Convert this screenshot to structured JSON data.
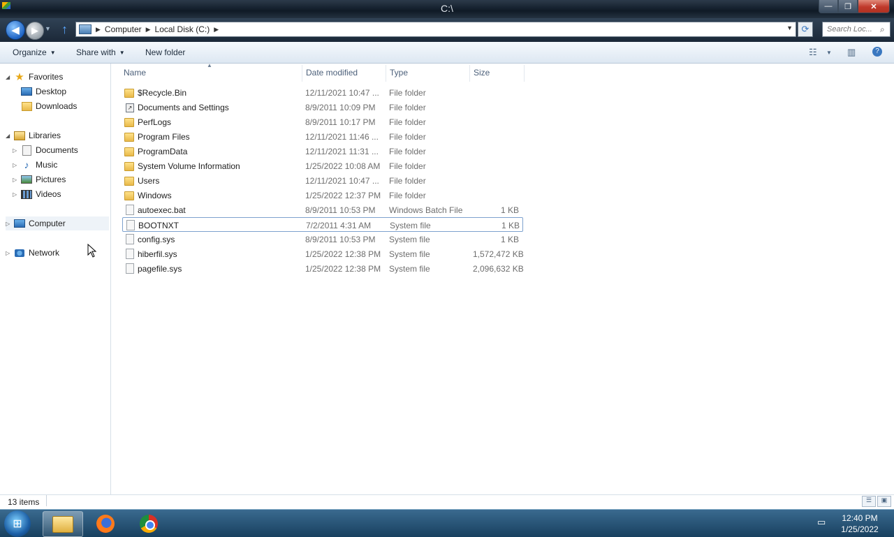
{
  "window": {
    "title": "C:\\",
    "minimize_label": "—",
    "maximize_label": "❐",
    "close_label": "✕"
  },
  "navigation": {
    "breadcrumbs": [
      "Computer",
      "Local Disk (C:)"
    ],
    "search_placeholder": "Search Loc..."
  },
  "toolbar": {
    "organize_label": "Organize",
    "share_label": "Share with",
    "new_folder_label": "New folder"
  },
  "sidebar": {
    "favorites": {
      "label": "Favorites",
      "items": [
        {
          "label": "Desktop",
          "icon": "desktop-icon"
        },
        {
          "label": "Downloads",
          "icon": "downloads-icon"
        }
      ]
    },
    "libraries": {
      "label": "Libraries",
      "items": [
        {
          "label": "Documents",
          "icon": "documents-icon"
        },
        {
          "label": "Music",
          "icon": "music-icon"
        },
        {
          "label": "Pictures",
          "icon": "pictures-icon"
        },
        {
          "label": "Videos",
          "icon": "videos-icon"
        }
      ]
    },
    "computer_label": "Computer",
    "network_label": "Network"
  },
  "columns": {
    "name": "Name",
    "date": "Date modified",
    "type": "Type",
    "size": "Size"
  },
  "files": [
    {
      "name": "$Recycle.Bin",
      "date": "12/11/2021 10:47 ...",
      "type": "File folder",
      "size": "",
      "kind": "folder"
    },
    {
      "name": "Documents and Settings",
      "date": "8/9/2011 10:09 PM",
      "type": "File folder",
      "size": "",
      "kind": "shortcut"
    },
    {
      "name": "PerfLogs",
      "date": "8/9/2011 10:17 PM",
      "type": "File folder",
      "size": "",
      "kind": "folder"
    },
    {
      "name": "Program Files",
      "date": "12/11/2021 11:46 ...",
      "type": "File folder",
      "size": "",
      "kind": "folder"
    },
    {
      "name": "ProgramData",
      "date": "12/11/2021 11:31 ...",
      "type": "File folder",
      "size": "",
      "kind": "folder"
    },
    {
      "name": "System Volume Information",
      "date": "1/25/2022 10:08 AM",
      "type": "File folder",
      "size": "",
      "kind": "folder"
    },
    {
      "name": "Users",
      "date": "12/11/2021 10:47 ...",
      "type": "File folder",
      "size": "",
      "kind": "folder"
    },
    {
      "name": "Windows",
      "date": "1/25/2022 12:37 PM",
      "type": "File folder",
      "size": "",
      "kind": "folder"
    },
    {
      "name": "autoexec.bat",
      "date": "8/9/2011 10:53 PM",
      "type": "Windows Batch File",
      "size": "1 KB",
      "kind": "file"
    },
    {
      "name": "BOOTNXT",
      "date": "7/2/2011 4:31 AM",
      "type": "System file",
      "size": "1 KB",
      "kind": "file"
    },
    {
      "name": "config.sys",
      "date": "8/9/2011 10:53 PM",
      "type": "System file",
      "size": "1 KB",
      "kind": "file"
    },
    {
      "name": "hiberfil.sys",
      "date": "1/25/2022 12:38 PM",
      "type": "System file",
      "size": "1,572,472 KB",
      "kind": "file"
    },
    {
      "name": "pagefile.sys",
      "date": "1/25/2022 12:38 PM",
      "type": "System file",
      "size": "2,096,632 KB",
      "kind": "file"
    }
  ],
  "status": {
    "item_count": "13 items"
  },
  "taskbar": {
    "apps": [
      {
        "name": "windows-explorer",
        "active": true
      },
      {
        "name": "firefox",
        "active": false
      },
      {
        "name": "chrome",
        "active": false
      }
    ],
    "time": "12:40 PM",
    "date": "1/25/2022"
  },
  "colors": {
    "accent": "#1f64c4",
    "taskbar": "#18405f",
    "folder": "#e9b94a"
  }
}
